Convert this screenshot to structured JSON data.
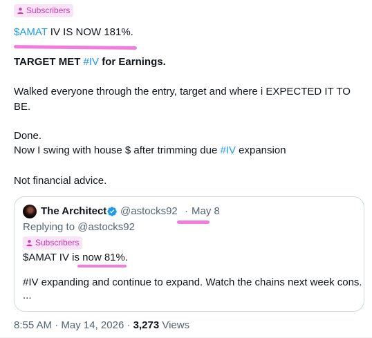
{
  "badge": {
    "label": "Subscribers"
  },
  "tweet": {
    "line1": {
      "cashtag": "$AMAT",
      "text": " IV IS NOW 181%."
    },
    "line2": {
      "prefix": "TARGET MET ",
      "hashtag": "#IV",
      "suffix": " for Earnings."
    },
    "line3": "Walked everyone through the entry, target and where i EXPECTED IT TO",
    "line4": "BE.",
    "line5": "Done.",
    "line6": {
      "prefix": "Now I swing with house $ after trimming due ",
      "hashtag": "#IV",
      "suffix": " expansion"
    },
    "line7": "Not financial advice."
  },
  "quote": {
    "author": "The Architect",
    "handle": "@astocks92",
    "separator": "·",
    "date": "May 8",
    "replying_to": "Replying to @astocks92",
    "badge_label": "Subscribers",
    "line1": "$AMAT IV is now 81%.",
    "line2": "#IV expanding and continue to expand. Watch the chains next week cons.",
    "line3": "..."
  },
  "meta": {
    "time": "8:55 AM",
    "separator": "·",
    "date": "May 14, 2026",
    "views_count": "3,273",
    "views_label": "Views"
  },
  "colors": {
    "link": "#1d9bf0",
    "badge_bg": "#fbe3f7",
    "badge_fg": "#c837ab",
    "highlight": "#f27cdb"
  }
}
